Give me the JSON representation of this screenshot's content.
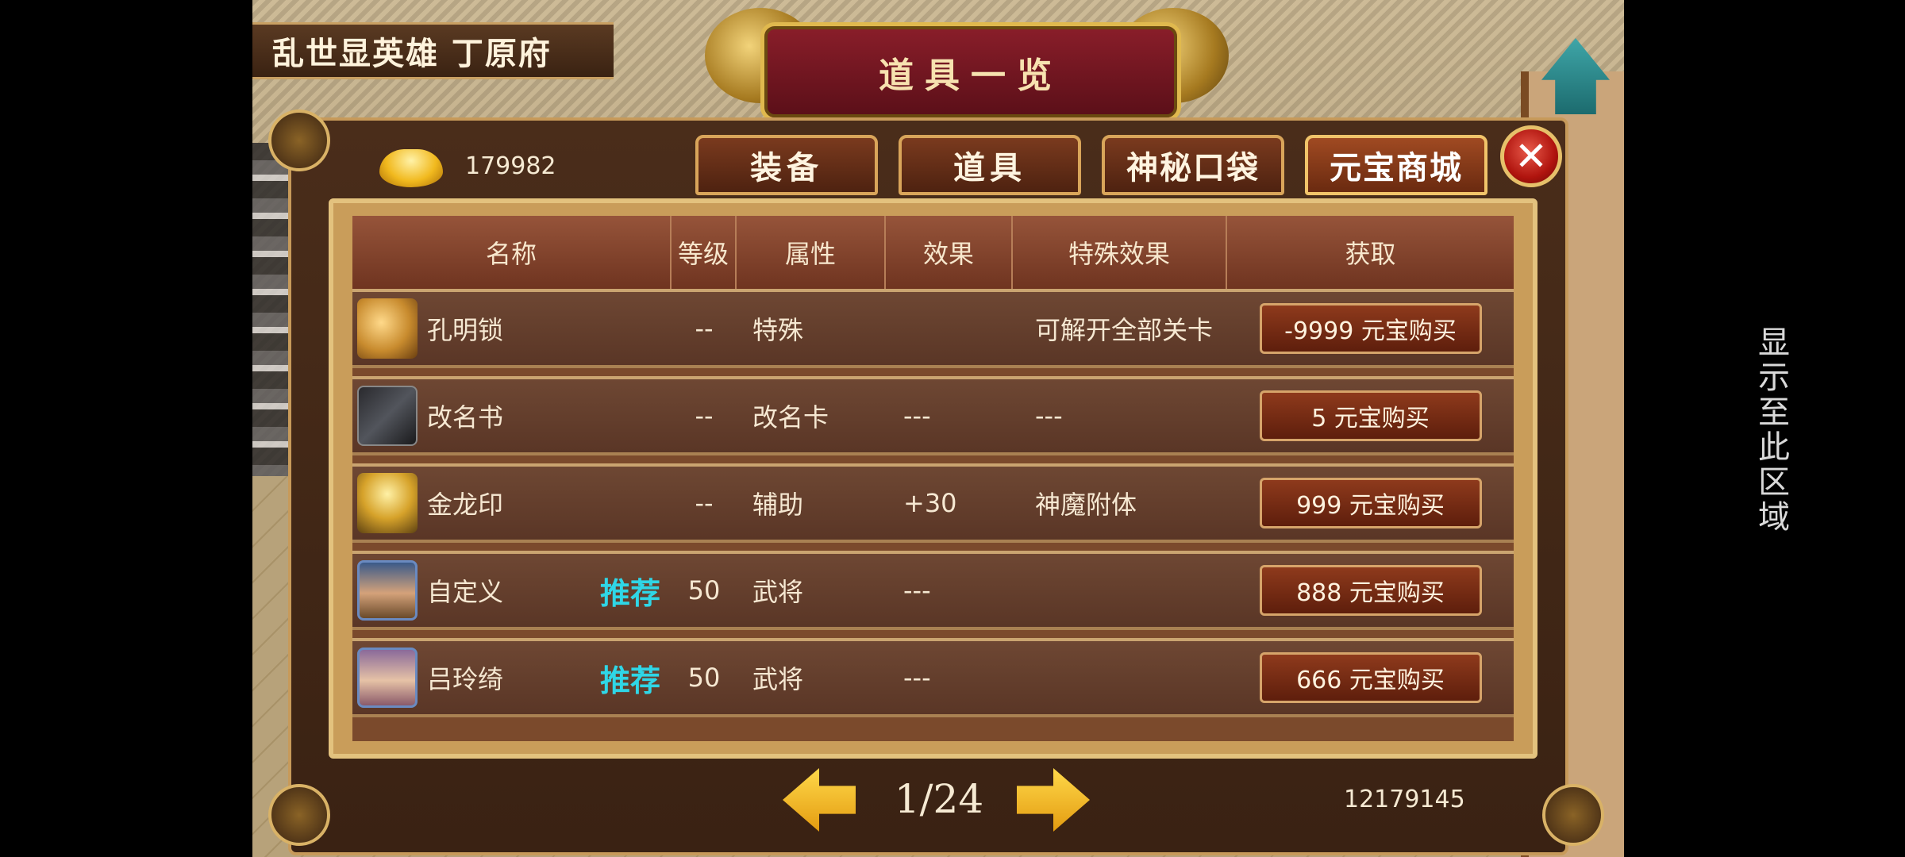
{
  "header": {
    "location": "乱世显英雄 丁原府",
    "title": "道具一览"
  },
  "currency": {
    "icon": "gold-ingot-icon",
    "amount": "179982"
  },
  "tabs": [
    {
      "label": "装备",
      "active": false
    },
    {
      "label": "道具",
      "active": false
    },
    {
      "label": "神秘口袋",
      "active": false
    },
    {
      "label": "元宝商城",
      "active": true
    }
  ],
  "table": {
    "headers": [
      "名称",
      "等级",
      "属性",
      "效果",
      "特殊效果",
      "获取"
    ],
    "rows": [
      {
        "icon": "kongming-lock-icon",
        "name": "孔明锁",
        "tag": "",
        "level": "--",
        "attr": "特殊",
        "effect": "",
        "special": "可解开全部关卡",
        "buy": "-9999 元宝购买"
      },
      {
        "icon": "rename-book-icon",
        "name": "改名书",
        "tag": "",
        "level": "--",
        "attr": "改名卡",
        "effect": "---",
        "special": "---",
        "buy": "5 元宝购买"
      },
      {
        "icon": "golden-dragon-seal-icon",
        "name": "金龙印",
        "tag": "",
        "level": "--",
        "attr": "辅助",
        "effect": "+30",
        "special": "神魔附体",
        "buy": "999 元宝购买"
      },
      {
        "icon": "hero-portrait-icon",
        "name": "自定义",
        "tag": "推荐",
        "level": "50",
        "attr": "武将",
        "effect": "---",
        "special": "",
        "buy": "888 元宝购买"
      },
      {
        "icon": "hero-portrait-icon",
        "name": "吕玲绮",
        "tag": "推荐",
        "level": "50",
        "attr": "武将",
        "effect": "---",
        "special": "",
        "buy": "666 元宝购买"
      }
    ]
  },
  "pager": {
    "text": "1/24"
  },
  "player_id": "12179145",
  "side_overlay": "显示至此区域",
  "colors": {
    "recommend": "#2fd6e6",
    "panel": "#4a2d1a",
    "accent_gold": "#e3c27e"
  }
}
